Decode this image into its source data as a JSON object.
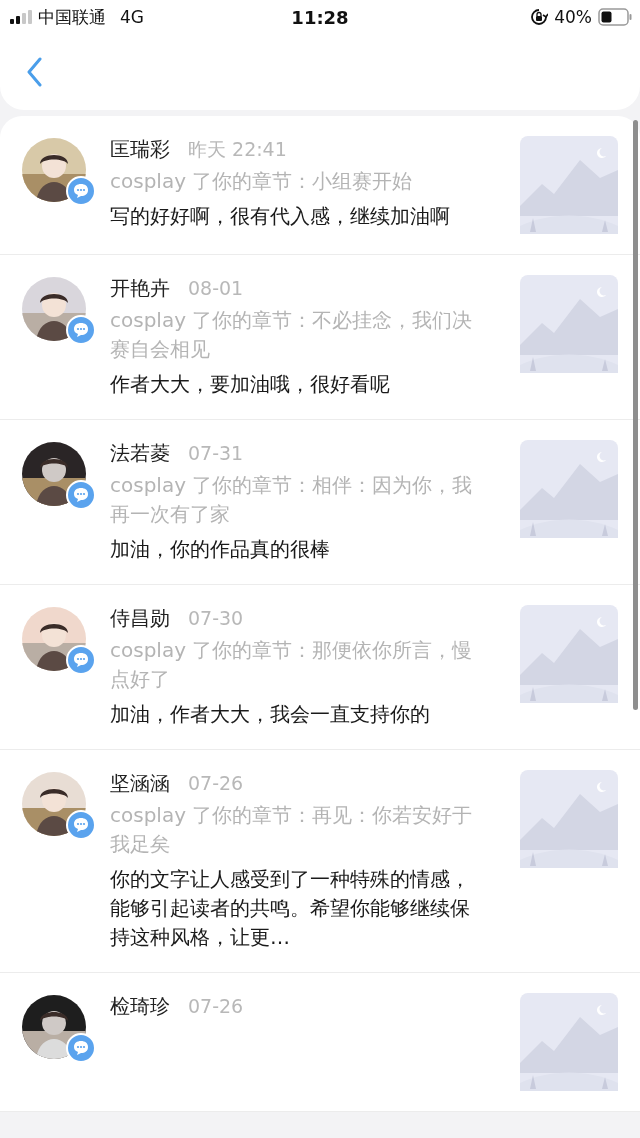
{
  "status_bar": {
    "carrier": "中国联通",
    "network": "4G",
    "time": "11:28",
    "battery": "40%"
  },
  "comments": [
    {
      "name": "匡瑞彩",
      "time": "昨天 22:41",
      "chapter": "cosplay 了你的章节：小组赛开始",
      "text": "写的好好啊，很有代入感，继续加油啊"
    },
    {
      "name": "开艳卉",
      "time": "08-01",
      "chapter": "cosplay 了你的章节：不必挂念，我们决赛自会相见",
      "text": "作者大大，要加油哦，很好看呢"
    },
    {
      "name": "法若菱",
      "time": "07-31",
      "chapter": "cosplay 了你的章节：相伴：因为你，我再一次有了家",
      "text": "加油，你的作品真的很棒"
    },
    {
      "name": "侍昌勋",
      "time": "07-30",
      "chapter": "cosplay 了你的章节：那便依你所言，慢点好了",
      "text": "加油，作者大大，我会一直支持你的"
    },
    {
      "name": "坚涵涵",
      "time": "07-26",
      "chapter": "cosplay 了你的章节：再见：你若安好于我足矣",
      "text": "你的文字让人感受到了一种特殊的情感，能够引起读者的共鸣。希望你能够继续保持这种风格，让更…"
    },
    {
      "name": "检琦珍",
      "time": "07-26"
    }
  ]
}
